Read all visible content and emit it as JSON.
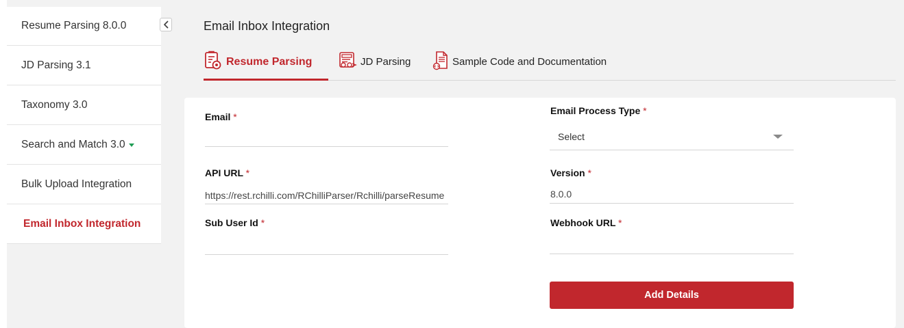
{
  "sidebar": {
    "items": [
      {
        "label": "Resume Parsing 8.0.0"
      },
      {
        "label": "JD Parsing 3.1"
      },
      {
        "label": "Taxonomy 3.0"
      },
      {
        "label": "Search and Match 3.0"
      },
      {
        "label": "Bulk Upload Integration"
      },
      {
        "label": "Email Inbox Integration"
      }
    ],
    "active_color": "#c1272d",
    "dropdown_caret_color": "#1f9d55"
  },
  "page": {
    "title": "Email Inbox Integration"
  },
  "tabs": [
    {
      "label": "Resume Parsing",
      "icon": "resume-document-icon",
      "active": true
    },
    {
      "label": "JD Parsing",
      "icon": "jd-document-icon",
      "active": false
    },
    {
      "label": "Sample Code and Documentation",
      "icon": "code-document-icon",
      "active": false
    }
  ],
  "form": {
    "required_mark": "*",
    "email": {
      "label": "Email",
      "value": ""
    },
    "email_process_type": {
      "label": "Email Process Type",
      "value": "Select"
    },
    "api_url": {
      "label": "API URL",
      "value": "https://rest.rchilli.com/RChilliParser/Rchilli/parseResume"
    },
    "version": {
      "label": "Version",
      "value": "8.0.0"
    },
    "sub_user_id": {
      "label": "Sub User Id",
      "value": ""
    },
    "webhook_url": {
      "label": "Webhook URL",
      "value": ""
    },
    "submit_label": "Add Details"
  },
  "colors": {
    "brand_red": "#c1272d",
    "background": "#f2f2f2"
  }
}
